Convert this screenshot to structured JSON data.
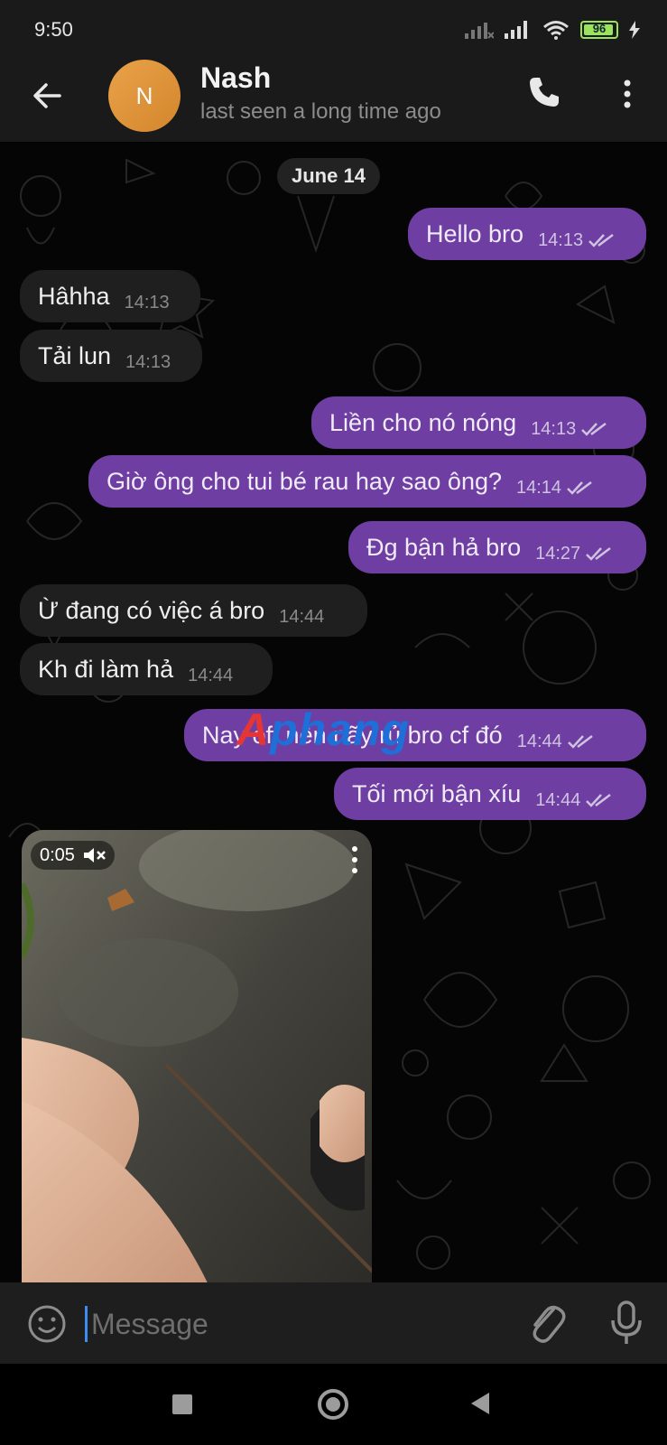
{
  "status_bar": {
    "time": "9:50",
    "battery": "96"
  },
  "header": {
    "avatar_initial": "N",
    "contact_name": "Nash",
    "contact_status": "last seen a long time ago"
  },
  "chat": {
    "date": "June 14",
    "messages": [
      {
        "direction": "out",
        "text": "Hello bro",
        "time": "14:13",
        "read": true
      },
      {
        "direction": "in",
        "text": "Hâhha",
        "time": "14:13"
      },
      {
        "direction": "in",
        "text": "Tải lun",
        "time": "14:13"
      },
      {
        "direction": "out",
        "text": "Liền cho nó nóng",
        "time": "14:13",
        "read": true
      },
      {
        "direction": "out",
        "text": "Giờ ông cho tui bé rau hay sao ông?",
        "time": "14:14",
        "read": true
      },
      {
        "direction": "out",
        "text": "Đg bận hả bro",
        "time": "14:27",
        "read": true
      },
      {
        "direction": "in",
        "text": "Ừ đang có việc á bro",
        "time": "14:44"
      },
      {
        "direction": "in",
        "text": "Kh đi làm hả",
        "time": "14:44"
      },
      {
        "direction": "out",
        "text": "Nay off nên nãy rủ bro cf đó",
        "time": "14:44",
        "read": true
      },
      {
        "direction": "out",
        "text": "Tối mới bận xíu",
        "time": "14:44",
        "read": true
      }
    ],
    "video": {
      "duration": "0:05",
      "muted": true
    }
  },
  "watermark": {
    "part1": "A",
    "part2": "phang"
  },
  "input": {
    "placeholder": "Message"
  },
  "colors": {
    "outgoing_bubble": "#6e3ea3",
    "incoming_bubble": "#1f1f1f",
    "background": "#000000",
    "cursor": "#3d8cf0"
  },
  "icons": [
    "back-arrow-icon",
    "phone-icon",
    "more-vert-icon",
    "double-check-icon",
    "mute-icon",
    "emoji-icon",
    "attach-icon",
    "mic-icon",
    "nav-recent-icon",
    "nav-home-icon",
    "nav-back-icon"
  ]
}
